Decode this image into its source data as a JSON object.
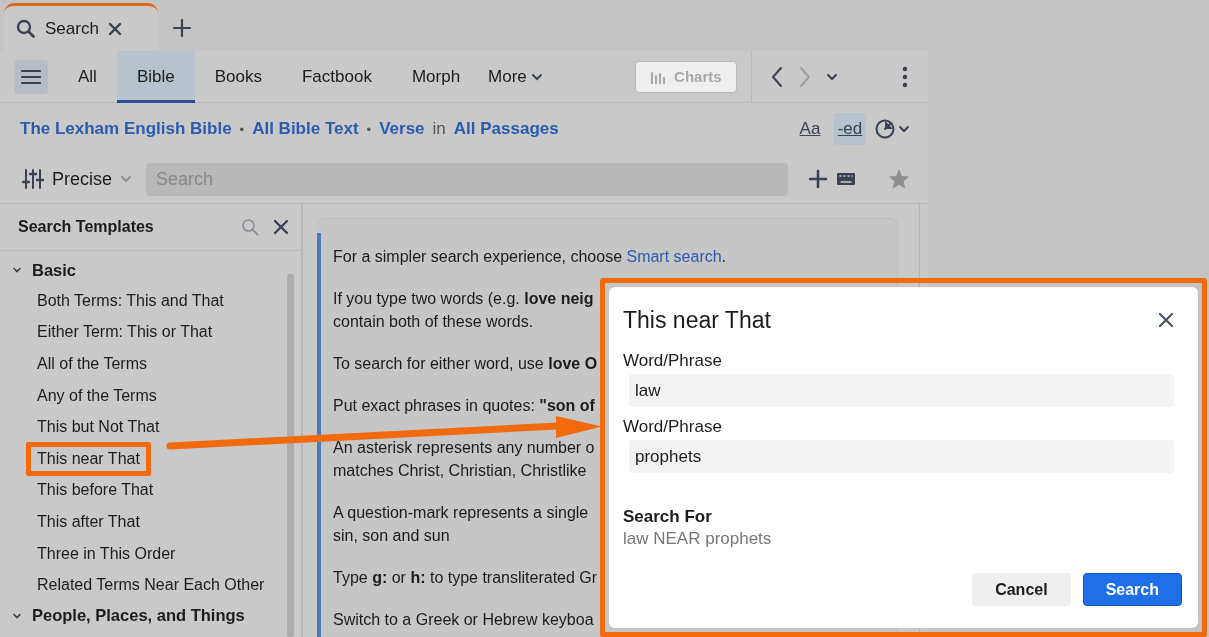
{
  "tabs": [
    {
      "label": "Search",
      "selected": true
    }
  ],
  "toolbar": {
    "tabs": [
      {
        "label": "All",
        "selected": false
      },
      {
        "label": "Bible",
        "selected": true
      },
      {
        "label": "Books",
        "selected": false
      },
      {
        "label": "Factbook",
        "selected": false
      },
      {
        "label": "Morph",
        "selected": false
      }
    ],
    "more": "More",
    "charts": {
      "label": "Charts",
      "disabled": true
    }
  },
  "scope": {
    "parts": [
      {
        "kind": "link",
        "text": "The Lexham English Bible"
      },
      {
        "kind": "sep",
        "text": "•"
      },
      {
        "kind": "link",
        "text": "All Bible Text"
      },
      {
        "kind": "sep",
        "text": "•"
      },
      {
        "kind": "link",
        "text": "Verse"
      },
      {
        "kind": "plain",
        "text": "in"
      },
      {
        "kind": "link",
        "text": "All Passages"
      }
    ],
    "tools": [
      {
        "text": "Aa",
        "selected": false
      },
      {
        "text": "-ed",
        "selected": true
      }
    ]
  },
  "search_row": {
    "mode": "Precise",
    "placeholder": "Search"
  },
  "sidebar": {
    "title": "Search Templates",
    "groups": [
      {
        "label": "Basic",
        "expanded": true,
        "children": [
          {
            "label": "Both Terms: This and That",
            "annotated": false
          },
          {
            "label": "Either Term: This or That",
            "annotated": false
          },
          {
            "label": "All of the Terms",
            "annotated": false
          },
          {
            "label": "Any of the Terms",
            "annotated": false
          },
          {
            "label": "This but Not That",
            "annotated": false
          },
          {
            "label": "This near That",
            "annotated": true
          },
          {
            "label": "This before That",
            "annotated": false
          },
          {
            "label": "This after That",
            "annotated": false
          },
          {
            "label": "Three in This Order",
            "annotated": false
          },
          {
            "label": "Related Terms Near Each Other",
            "annotated": false
          }
        ]
      },
      {
        "label": "People, Places, and Things",
        "expanded": true
      }
    ]
  },
  "help": [
    {
      "lines": [
        [
          {
            "kind": "text",
            "text": "For a simpler search experience, choose "
          },
          {
            "kind": "link",
            "text": "Smart search"
          },
          {
            "kind": "text",
            "text": "."
          }
        ]
      ]
    },
    {
      "lines": [
        [
          {
            "kind": "text",
            "text": "If you type two words (e.g. **love neig**"
          }
        ],
        [
          {
            "kind": "text",
            "text": "contain both of these words."
          }
        ]
      ]
    },
    {
      "lines": [
        [
          {
            "kind": "text",
            "text": "To search for either word, use **love O**"
          }
        ]
      ]
    },
    {
      "lines": [
        [
          {
            "kind": "text",
            "text": "Put exact phrases in quotes: **\"son of**"
          }
        ]
      ]
    },
    {
      "lines": [
        [
          {
            "kind": "text",
            "text": "An asterisk represents any number o"
          }
        ],
        [
          {
            "kind": "text",
            "text": "matches Christ, Christian, Christlike"
          }
        ]
      ]
    },
    {
      "lines": [
        [
          {
            "kind": "text",
            "text": "A question-mark represents a single"
          }
        ],
        [
          {
            "kind": "text",
            "text": "sin, son and sun"
          }
        ]
      ]
    },
    {
      "lines": [
        [
          {
            "kind": "text",
            "text": "Type **g:** or **h:** to type transliterated Gr"
          }
        ]
      ]
    },
    {
      "lines": [
        [
          {
            "kind": "text",
            "text": "Switch to a Greek or Hebrew keyboa"
          }
        ]
      ]
    }
  ],
  "dialog": {
    "title": "This near That",
    "annotated": true,
    "fields": [
      {
        "label": "Word/Phrase",
        "value": "law"
      },
      {
        "label": "Word/Phrase",
        "value": "prophets"
      }
    ],
    "result_label": "Search For",
    "result": "law NEAR prophets",
    "buttons": [
      {
        "label": "Cancel",
        "kind": "secondary"
      },
      {
        "label": "Search",
        "kind": "primary"
      }
    ]
  }
}
